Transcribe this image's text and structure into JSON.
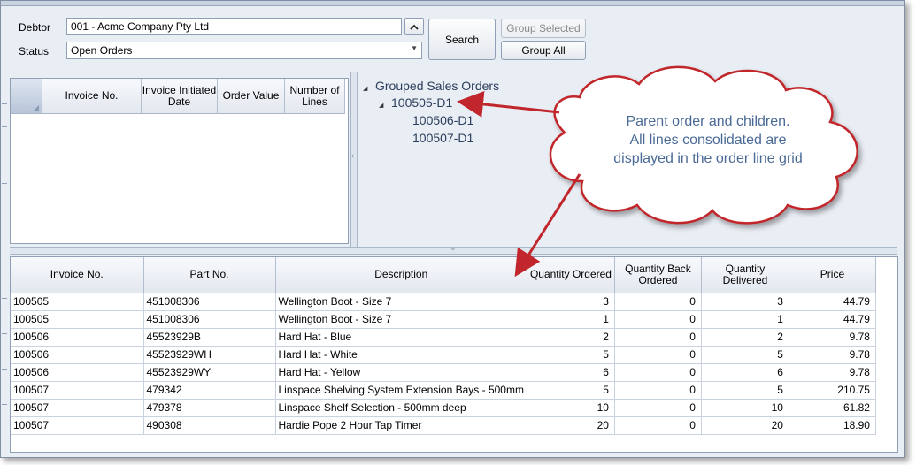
{
  "filters": {
    "debtor_label": "Debtor",
    "debtor_value": "001 - Acme Company Pty Ltd",
    "status_label": "Status",
    "status_value": "Open Orders"
  },
  "buttons": {
    "search": "Search",
    "group_selected": "Group Selected",
    "group_all": "Group All"
  },
  "invoice_grid": {
    "columns": [
      "Invoice No.",
      "Invoice Initiated Date",
      "Order Value",
      "Number of Lines"
    ]
  },
  "tree": {
    "root": "Grouped Sales Orders",
    "parent": "100505-D1",
    "children": [
      "100506-D1",
      "100507-D1"
    ]
  },
  "callout": {
    "lines": [
      "Parent order and children.",
      "All lines consolidated are",
      "displayed in the order line grid"
    ]
  },
  "lines_grid": {
    "columns": [
      "Invoice No.",
      "Part No.",
      "Description",
      "Quantity Ordered",
      "Quantity Back Ordered",
      "Quantity Delivered",
      "Price"
    ],
    "rows": [
      [
        "100505",
        "451008306",
        "Wellington Boot - Size 7",
        "3",
        "0",
        "3",
        "44.79"
      ],
      [
        "100505",
        "451008306",
        "Wellington Boot - Size 7",
        "1",
        "0",
        "1",
        "44.79"
      ],
      [
        "100506",
        "45523929B",
        "Hard Hat - Blue",
        "2",
        "0",
        "2",
        "9.78"
      ],
      [
        "100506",
        "45523929WH",
        "Hard Hat - White",
        "5",
        "0",
        "5",
        "9.78"
      ],
      [
        "100506",
        "45523929WY",
        "Hard Hat - Yellow",
        "6",
        "0",
        "6",
        "9.78"
      ],
      [
        "100507",
        "479342",
        "Linspace Shelving System Extension Bays - 500mm",
        "5",
        "0",
        "5",
        "210.75"
      ],
      [
        "100507",
        "479378",
        "Linspace Shelf Selection - 500mm deep",
        "10",
        "0",
        "10",
        "61.82"
      ],
      [
        "100507",
        "490308",
        "Hardie Pope 2 Hour Tap Timer",
        "20",
        "0",
        "20",
        "18.90"
      ]
    ]
  },
  "icons": {
    "collapse_filters": "chevron-up-icon",
    "status_dropdown": "chevron-down-icon",
    "tree_expand": "triangle-expanded-icon"
  },
  "colors": {
    "callout_text": "#4a6a96",
    "callout_border": "#c0262c",
    "arrow": "#c0262c"
  }
}
